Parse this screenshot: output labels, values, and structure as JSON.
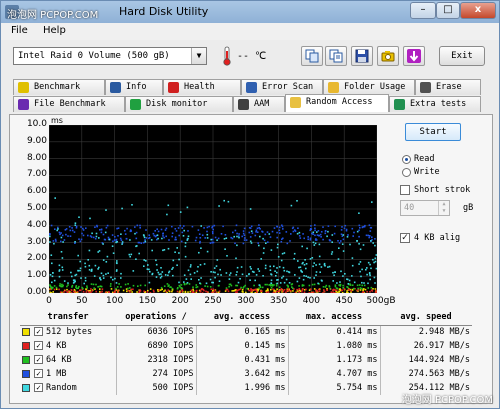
{
  "window": {
    "title": "Hard Disk Utility",
    "watermark_top": "泡泡网 PCPOP.COM",
    "watermark_bottom": "泡泡网 PCPOP.COM",
    "controls": [
      "–",
      "□",
      "x"
    ]
  },
  "menu": {
    "items": [
      "File",
      "Help"
    ]
  },
  "toolbar": {
    "drive": "Intel   Raid 0 Volume (500 gB)",
    "temperature": "-- ℃",
    "exit_label": "Exit"
  },
  "tabs": {
    "row1": [
      {
        "label": "Benchmark",
        "icon": "benchmark-icon"
      },
      {
        "label": "Info",
        "icon": "info-icon"
      },
      {
        "label": "Health",
        "icon": "health-icon"
      },
      {
        "label": "Error Scan",
        "icon": "error-scan-icon"
      },
      {
        "label": "Folder Usage",
        "icon": "folder-icon"
      },
      {
        "label": "Erase",
        "icon": "erase-icon"
      }
    ],
    "row2": [
      {
        "label": "File Benchmark",
        "icon": "file-benchmark-icon"
      },
      {
        "label": "Disk monitor",
        "icon": "disk-monitor-icon"
      },
      {
        "label": "AAM",
        "icon": "speaker-icon"
      },
      {
        "label": "Random Access",
        "icon": "random-access-icon"
      },
      {
        "label": "Extra tests",
        "icon": "extra-tests-icon"
      }
    ]
  },
  "controls": {
    "start_label": "Start",
    "mode_options": [
      "Read",
      "Write"
    ],
    "mode_selected": "Read",
    "short_stroke_label": "Short strok",
    "short_stroke_checked": false,
    "stroke_value": "40",
    "stroke_unit": "gB",
    "align_label": "4 KB alig",
    "align_checked": true
  },
  "chart_data": {
    "type": "scatter",
    "ylabel": "ms",
    "xlim": [
      0,
      500
    ],
    "ylim": [
      0,
      10
    ],
    "x_ticks": [
      "0",
      "50",
      "100",
      "150",
      "200",
      "250",
      "300",
      "350",
      "400",
      "450",
      "500gB"
    ],
    "y_ticks": [
      "0.00",
      "1.00",
      "2.00",
      "3.00",
      "4.00",
      "5.00",
      "6.00",
      "7.00",
      "8.00",
      "9.00",
      "10.0"
    ],
    "grid": true,
    "background": "#000000",
    "series": [
      {
        "name": "512 bytes",
        "color": "#f0e000",
        "band": [
          0.05,
          0.3
        ]
      },
      {
        "name": "4 KB",
        "color": "#e02020",
        "band": [
          0.05,
          0.3
        ]
      },
      {
        "name": "64 KB",
        "color": "#20c020",
        "band": [
          0.3,
          0.6
        ]
      },
      {
        "name": "1 MB",
        "color": "#2050e0",
        "band": [
          3.0,
          4.1
        ]
      },
      {
        "name": "Random",
        "color": "#40d8e0",
        "band": [
          0.5,
          5.7
        ]
      }
    ]
  },
  "results": {
    "headers": [
      "transfer",
      "operations /",
      "avg. access",
      "max. access",
      "avg. speed"
    ],
    "rows": [
      {
        "color": "#f0e000",
        "transfer": "512 bytes",
        "ops": "6036 IOPS",
        "avg": "0.165 ms",
        "max": "0.414 ms",
        "speed": "2.948 MB/s"
      },
      {
        "color": "#e02020",
        "transfer": "4 KB",
        "ops": "6890 IOPS",
        "avg": "0.145 ms",
        "max": "1.080 ms",
        "speed": "26.917 MB/s"
      },
      {
        "color": "#20c020",
        "transfer": "64 KB",
        "ops": "2318 IOPS",
        "avg": "0.431 ms",
        "max": "1.173 ms",
        "speed": "144.924 MB/s"
      },
      {
        "color": "#2050e0",
        "transfer": "1 MB",
        "ops": "274 IOPS",
        "avg": "3.642 ms",
        "max": "4.707 ms",
        "speed": "274.563 MB/s"
      },
      {
        "color": "#40d8e0",
        "transfer": "Random",
        "ops": "500 IOPS",
        "avg": "1.996 ms",
        "max": "5.754 ms",
        "speed": "254.112 MB/s"
      }
    ]
  }
}
